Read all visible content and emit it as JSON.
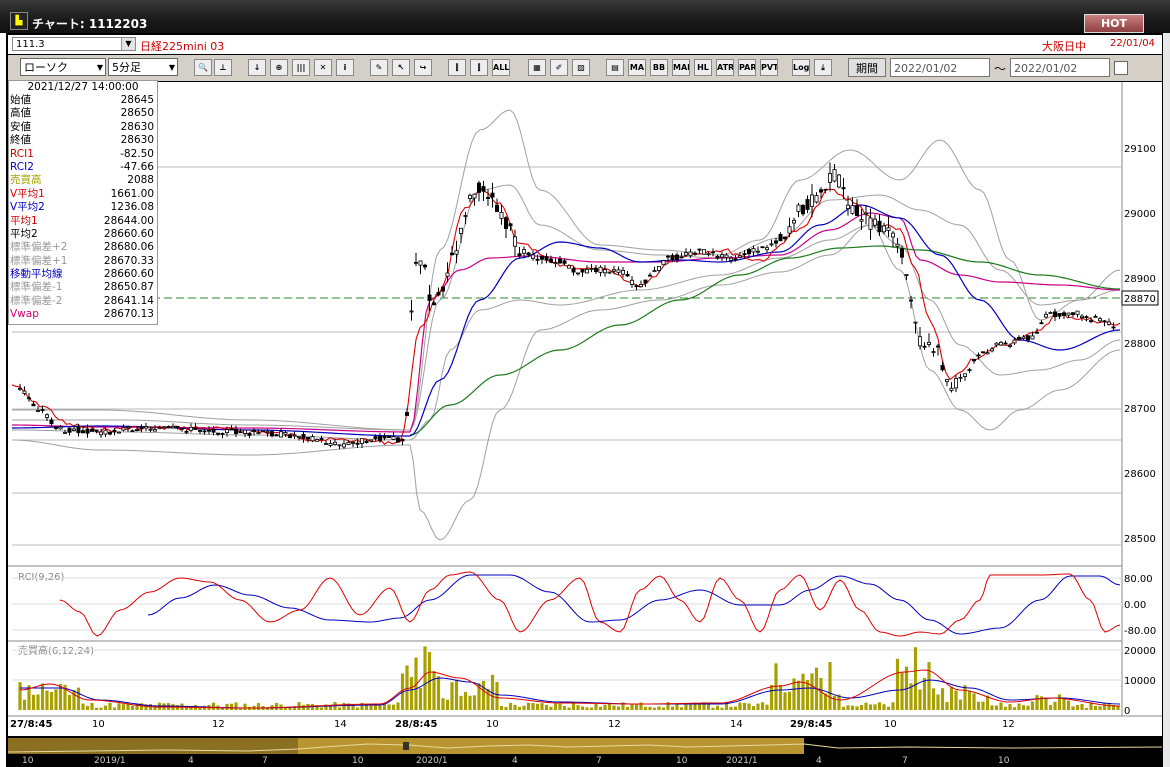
{
  "window": {
    "title": "チャート: 1112203",
    "hot_label": "HOT",
    "icon": "app-chart-icon"
  },
  "row1": {
    "code": "111.3",
    "instrument": "日経225mini 03",
    "session": "大阪日中",
    "date": "22/01/04"
  },
  "toolbar": {
    "chart_type": "ローソク",
    "interval": "5分足",
    "buttons": [
      {
        "name": "zoom",
        "label": "🔍"
      },
      {
        "name": "crosshair",
        "label": "⊥"
      },
      {
        "name": "down",
        "label": "↓"
      },
      {
        "name": "zoom-in",
        "label": "⊕"
      },
      {
        "name": "bar",
        "label": "|||"
      },
      {
        "name": "cross",
        "label": "✕"
      },
      {
        "name": "info",
        "label": "i"
      },
      {
        "name": "pen",
        "label": "✎"
      },
      {
        "name": "cursor",
        "label": "↖"
      },
      {
        "name": "hook",
        "label": "↪"
      },
      {
        "name": "candle1",
        "label": "⫿"
      },
      {
        "name": "candle2",
        "label": "⫿"
      },
      {
        "name": "all",
        "label": "ALL"
      },
      {
        "name": "grid",
        "label": "▦"
      },
      {
        "name": "brush",
        "label": "✐"
      },
      {
        "name": "color",
        "label": "▨"
      },
      {
        "name": "gap",
        "label": "▤"
      },
      {
        "name": "ma",
        "label": "MA"
      },
      {
        "name": "bb",
        "label": "BB"
      },
      {
        "name": "mae",
        "label": "MAE"
      },
      {
        "name": "hl",
        "label": "HL"
      },
      {
        "name": "atr",
        "label": "ATR"
      },
      {
        "name": "para",
        "label": "PARA"
      },
      {
        "name": "pvt",
        "label": "PVT"
      },
      {
        "name": "log",
        "label": "Log"
      },
      {
        "name": "save",
        "label": "⤓"
      }
    ],
    "period_label": "期間",
    "date_from": "2022/01/02",
    "date_to": "2022/01/02",
    "tilde": "〜"
  },
  "info": {
    "datetime": "2021/12/27  14:00:00",
    "rows": [
      {
        "label": "始値",
        "value": "28645",
        "color": "#000000"
      },
      {
        "label": "高値",
        "value": "28650",
        "color": "#000000"
      },
      {
        "label": "安値",
        "value": "28630",
        "color": "#000000"
      },
      {
        "label": "終値",
        "value": "28630",
        "color": "#000000"
      },
      {
        "label": "RCI1",
        "value": "-82.50",
        "color": "#d00000"
      },
      {
        "label": "RCI2",
        "value": "-47.66",
        "color": "#0000c0"
      },
      {
        "label": "売買高",
        "value": "2088",
        "color": "#a0a000"
      },
      {
        "label": "V平均1",
        "value": "1661.00",
        "color": "#d00000"
      },
      {
        "label": "V平均2",
        "value": "1236.08",
        "color": "#0000c0"
      },
      {
        "label": "平均1",
        "value": "28644.00",
        "color": "#d00000"
      },
      {
        "label": "平均2",
        "value": "28660.60",
        "color": "#000000"
      },
      {
        "label": "標準偏差+2",
        "value": "28680.06",
        "color": "#999999"
      },
      {
        "label": "標準偏差+1",
        "value": "28670.33",
        "color": "#999999"
      },
      {
        "label": "移動平均線",
        "value": "28660.60",
        "color": "#0000c0"
      },
      {
        "label": "標準偏差-1",
        "value": "28650.87",
        "color": "#999999"
      },
      {
        "label": "標準偏差-2",
        "value": "28641.14",
        "color": "#999999"
      },
      {
        "label": "Vwap",
        "value": "28670.13",
        "color": "#cc0077"
      }
    ]
  },
  "price_axis": {
    "ticks": [
      "29100",
      "29000",
      "28900",
      "28800",
      "28700",
      "28600",
      "28500"
    ],
    "current": "28870"
  },
  "rci_panel": {
    "label": "RCI(9,26)",
    "ticks": [
      "80.00",
      "0.00",
      "-80.00"
    ]
  },
  "volume_panel": {
    "label": "売買高(6,12,24)",
    "ticks": [
      "20000",
      "10000",
      "0"
    ]
  },
  "x_axis": [
    "27/8:45",
    "10",
    "12",
    "14",
    "28/8:45",
    "10",
    "12",
    "14",
    "29/8:45",
    "10",
    "12"
  ],
  "timeline": [
    "10",
    "2019/1",
    "4",
    "7",
    "10",
    "2020/1",
    "4",
    "7",
    "10",
    "2021/1",
    "4",
    "7",
    "10"
  ]
}
